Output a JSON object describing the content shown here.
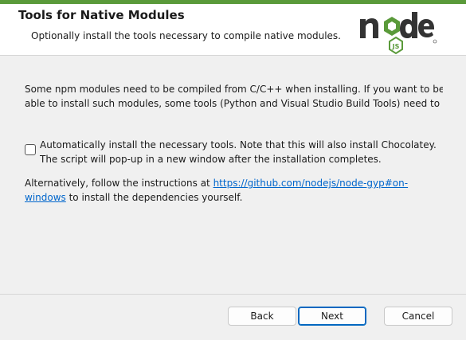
{
  "header": {
    "title": "Tools for Native Modules",
    "subtitle": "Optionally install the tools necessary to compile native modules.",
    "logo_icon": "nodejs-logo",
    "accent_color": "#5a9a3a"
  },
  "content": {
    "paragraph1_line1": "Some npm modules need to be compiled from C/C++ when installing. If you want to be",
    "paragraph1_line2": "able to install such modules, some tools (Python and Visual Studio Build Tools) need to b...",
    "checkbox": {
      "checked": false,
      "label": "Automatically install the necessary tools. Note that this will also install Chocolatey. The script will pop-up in a new window after the installation completes."
    },
    "paragraph3_before": "Alternatively, follow the instructions at ",
    "paragraph3_link": "https://github.com/nodejs/node-gyp#on-windows",
    "paragraph3_after": " to install the dependencies yourself.",
    "link_color": "#0066cc"
  },
  "buttons": {
    "back": "Back",
    "next": "Next",
    "cancel": "Cancel"
  }
}
